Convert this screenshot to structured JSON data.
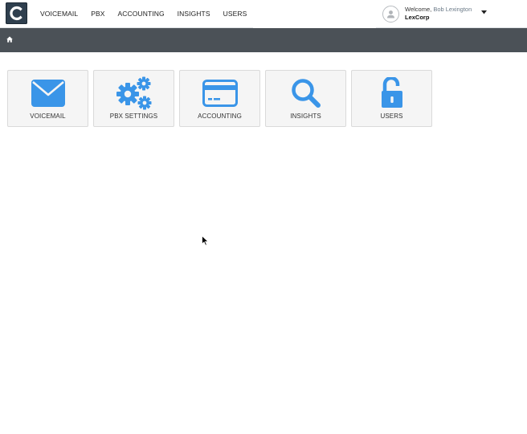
{
  "app": {
    "logo_letter": "C"
  },
  "nav": {
    "items": [
      {
        "label": "VOICEMAIL"
      },
      {
        "label": "PBX"
      },
      {
        "label": "ACCOUNTING"
      },
      {
        "label": "INSIGHTS"
      },
      {
        "label": "USERS"
      }
    ]
  },
  "user": {
    "welcome_prefix": "Welcome,",
    "name": "Bob Lexington",
    "company": "LexCorp"
  },
  "tiles": [
    {
      "label": "VOICEMAIL",
      "icon": "envelope-icon"
    },
    {
      "label": "PBX SETTINGS",
      "icon": "gears-icon"
    },
    {
      "label": "ACCOUNTING",
      "icon": "credit-card-icon"
    },
    {
      "label": "INSIGHTS",
      "icon": "magnifier-icon"
    },
    {
      "label": "USERS",
      "icon": "unlock-icon"
    }
  ],
  "colors": {
    "accent": "#3a95e8",
    "breadcrumb_bar": "#4b5157",
    "logo_bg": "#2f3f4e",
    "tile_bg": "#f5f5f5"
  }
}
